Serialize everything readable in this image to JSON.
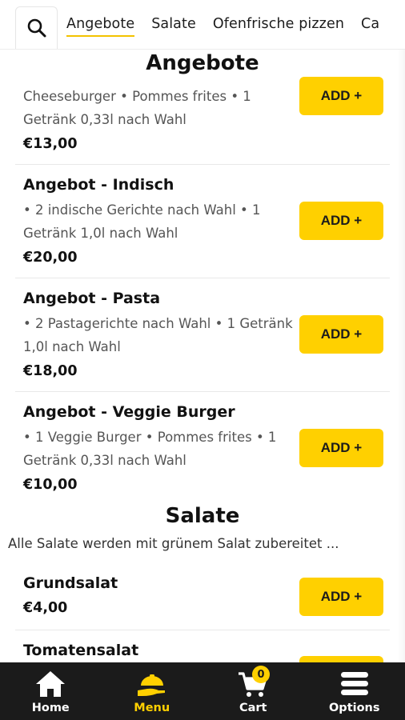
{
  "tabs": [
    {
      "label": "Angebote"
    },
    {
      "label": "Salate"
    },
    {
      "label": "Ofenfrische pizzen"
    },
    {
      "label": "Ca"
    }
  ],
  "sections": [
    {
      "title": "Angebote",
      "items": [
        {
          "name": "",
          "description": "Cheeseburger • Pommes frites • 1 Getränk 0,33l nach Wahl",
          "price": "€13,00",
          "add_label": "ADD +"
        },
        {
          "name": "Angebot - Indisch",
          "description": "• 2 indische Gerichte nach Wahl • 1 Getränk 1,0l nach Wahl",
          "price": "€20,00",
          "add_label": "ADD +"
        },
        {
          "name": "Angebot - Pasta",
          "description": "• 2 Pastagerichte nach Wahl • 1 Getränk 1,0l nach Wahl",
          "price": "€18,00",
          "add_label": "ADD +"
        },
        {
          "name": "Angebot - Veggie Burger",
          "description": "• 1 Veggie Burger • Pommes frites • 1 Getränk 0,33l nach Wahl",
          "price": "€10,00",
          "add_label": "ADD +"
        }
      ]
    },
    {
      "title": "Salate",
      "description": "Alle Salate werden mit grünem Salat zubereitet ...",
      "items": [
        {
          "name": "Grundsalat",
          "price": "€4,00",
          "add_label": "ADD +"
        },
        {
          "name": "Tomatensalat",
          "add_label": ""
        }
      ]
    }
  ],
  "bottom_nav": [
    {
      "label": "Home",
      "icon": "home-icon"
    },
    {
      "label": "Menu",
      "icon": "menu-dish-icon",
      "active": true
    },
    {
      "label": "Cart",
      "icon": "cart-icon",
      "badge": "0"
    },
    {
      "label": "Options",
      "icon": "hamburger-icon"
    }
  ],
  "colors": {
    "accent": "#ffd000",
    "nav_background": "#1b1b1b",
    "text": "#1c1c1c"
  }
}
